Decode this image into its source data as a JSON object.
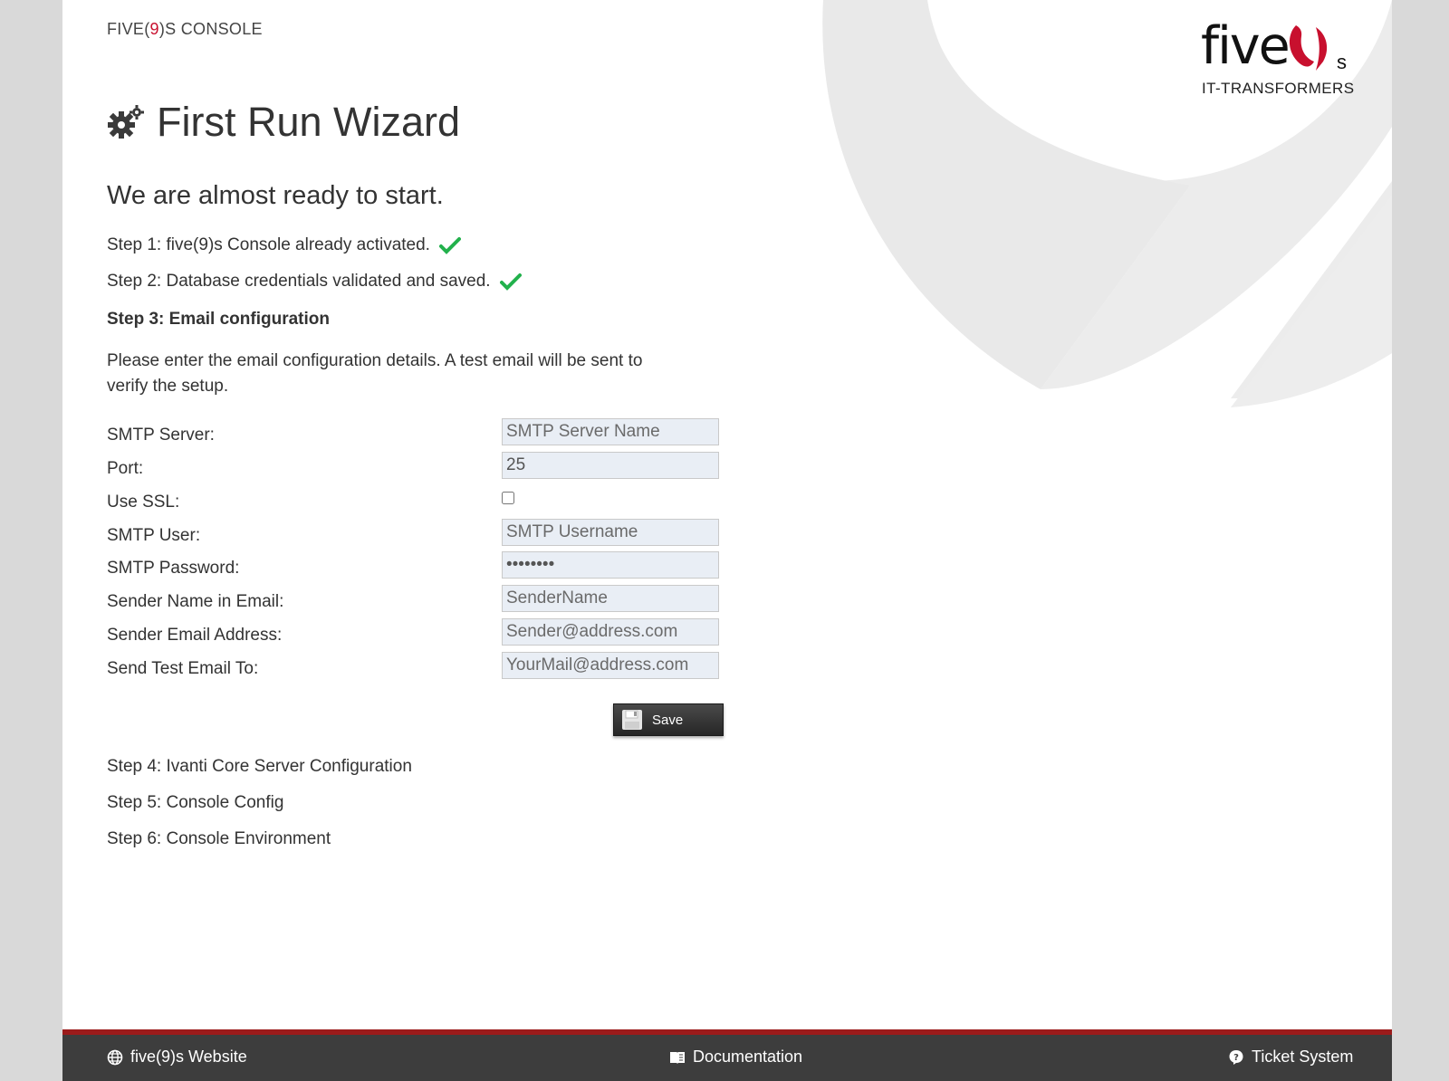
{
  "header": {
    "console_title_pre": "FIVE(",
    "console_title_nine": "9",
    "console_title_post": ")S CONSOLE",
    "logo_text": "five",
    "logo_s": "s",
    "logo_tagline": "IT-TRANSFORMERS"
  },
  "wizard": {
    "title": "First Run Wizard",
    "subtitle": "We are almost ready to start.",
    "steps": [
      {
        "label": "Step 1: five(9)s Console already activated.",
        "done": true
      },
      {
        "label": "Step 2: Database credentials validated and saved.",
        "done": true
      },
      {
        "label": "Step 3: Email configuration",
        "active": true
      },
      {
        "label": "Step 4: Ivanti Core Server Configuration"
      },
      {
        "label": "Step 5: Console Config"
      },
      {
        "label": "Step 6: Console Environment"
      }
    ],
    "description": "Please enter the email configuration details. A test email will be sent to verify the setup."
  },
  "form": {
    "smtp_server": {
      "label": "SMTP Server:",
      "placeholder": "SMTP Server Name",
      "value": ""
    },
    "port": {
      "label": "Port:",
      "value": "25"
    },
    "use_ssl": {
      "label": "Use SSL:",
      "checked": false
    },
    "smtp_user": {
      "label": "SMTP User:",
      "placeholder": "SMTP Username",
      "value": ""
    },
    "smtp_password": {
      "label": "SMTP Password:",
      "value": "password"
    },
    "sender_name": {
      "label": "Sender Name in Email:",
      "placeholder": "SenderName",
      "value": ""
    },
    "sender_email": {
      "label": "Sender Email Address:",
      "placeholder": "Sender@address.com",
      "value": ""
    },
    "test_email": {
      "label": "Send Test Email To:",
      "placeholder": "YourMail@address.com",
      "value": ""
    },
    "save_label": "Save"
  },
  "footer": {
    "website": "five(9)s Website",
    "documentation": "Documentation",
    "tickets": "Ticket System"
  },
  "colors": {
    "brand_red": "#c8102e",
    "check_green": "#22b14c",
    "footer_bg": "#3d3d3d",
    "footer_accent": "#9b1b1b"
  },
  "icons": {
    "wizard": "gears-icon",
    "check": "checkmark-icon",
    "save": "floppy-disk-icon",
    "website": "globe-icon",
    "documentation": "book-icon",
    "tickets": "question-circle-icon"
  }
}
